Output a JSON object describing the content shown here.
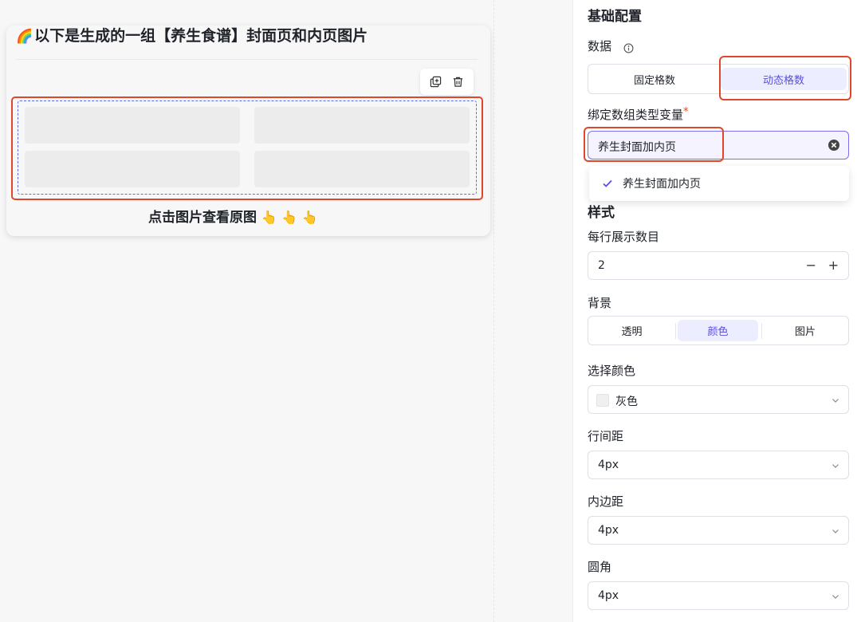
{
  "card": {
    "title_emoji": "🌈",
    "title": "以下是生成的一组【养生食谱】封面页和内页图片",
    "caption": "点击图片查看原图",
    "caption_emoji": "👆 👆 👆",
    "toolbar": {
      "copy_icon": "copy-icon",
      "delete_icon": "trash-icon"
    }
  },
  "panel": {
    "basic_config": "基础配置",
    "data_label": "数据",
    "info_icon": "info-icon",
    "data_mode": {
      "options": [
        "固定格数",
        "动态格数"
      ],
      "selected": "动态格数"
    },
    "bind_label": "绑定数组类型变量",
    "required_mark": "*",
    "bind_value": "养生封面加内页",
    "dropdown_option": "养生封面加内页",
    "style_title": "样式",
    "per_row_label": "每行展示数目",
    "per_row_value": "2",
    "minus": "−",
    "plus": "+",
    "background_label": "背景",
    "background": {
      "options": [
        "透明",
        "颜色",
        "图片"
      ],
      "selected": "颜色"
    },
    "color_label": "选择颜色",
    "color_value": "灰色",
    "color_swatch": "#f0f0f0",
    "row_gap_label": "行间距",
    "row_gap_value": "4px",
    "padding_label": "内边距",
    "padding_value": "4px",
    "radius_label": "圆角",
    "radius_value": "4px"
  },
  "colors": {
    "accent": "#5b4ee0",
    "highlight": "#e0462a",
    "active_bg": "#eceeff"
  }
}
